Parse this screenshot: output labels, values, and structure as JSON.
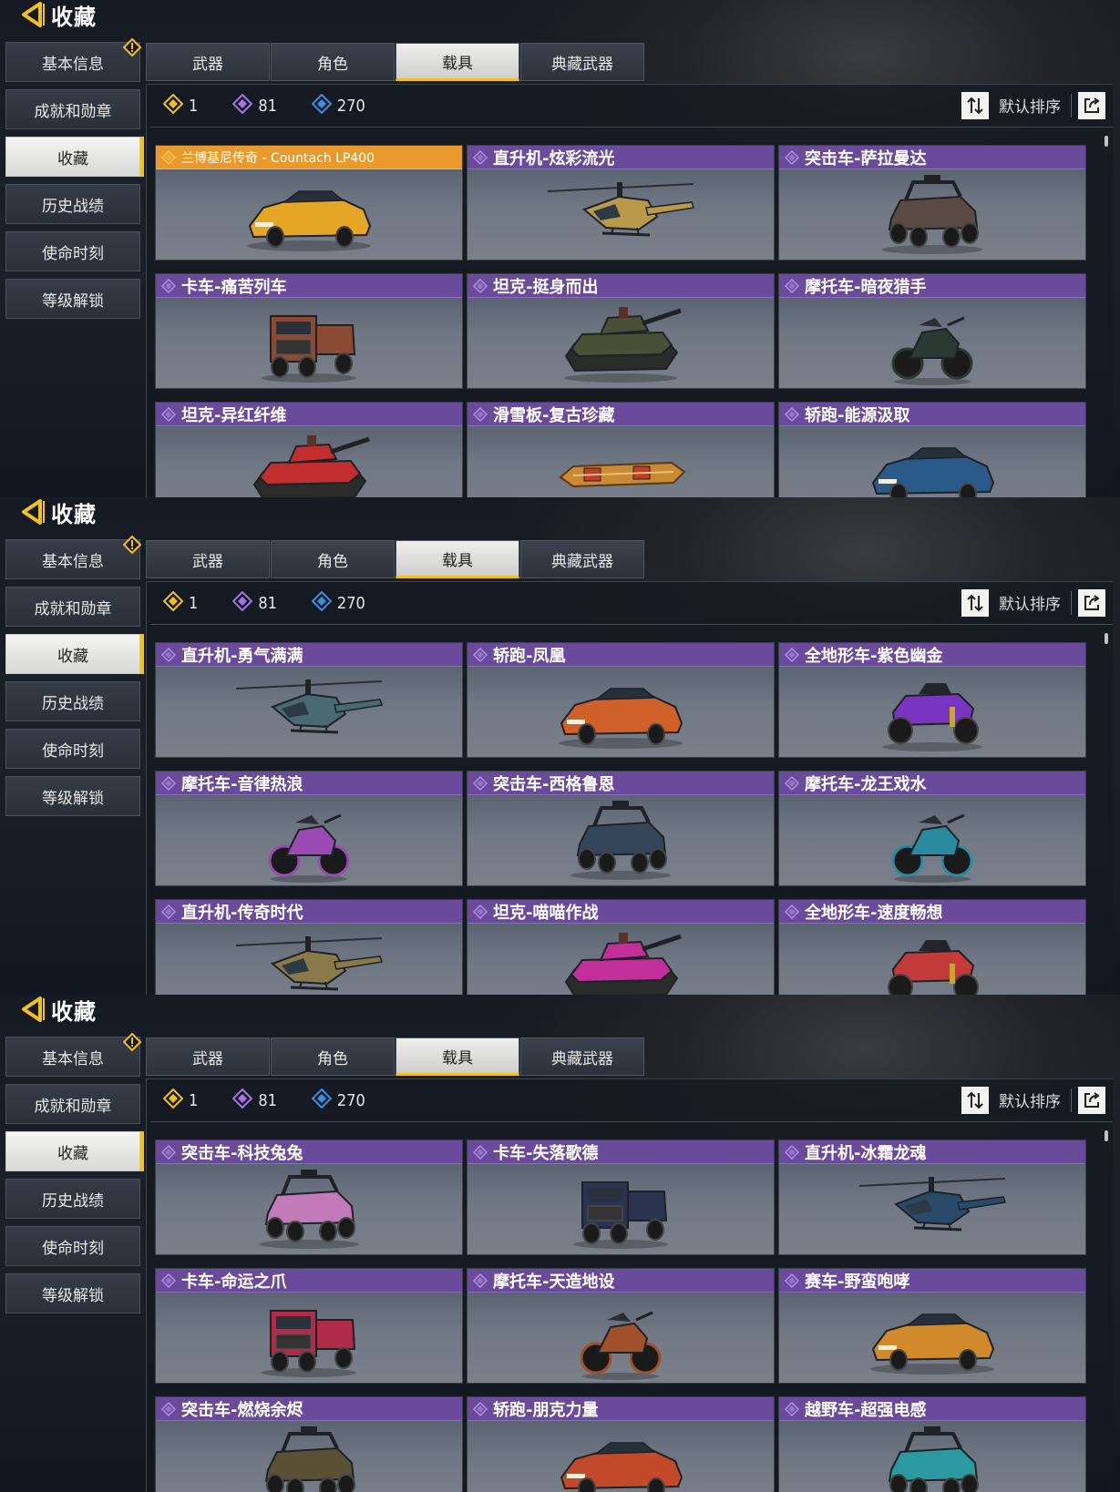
{
  "page_title": "收藏",
  "side_nav": [
    {
      "label": "基本信息",
      "warning": true
    },
    {
      "label": "成就和勋章"
    },
    {
      "label": "收藏",
      "active": true
    },
    {
      "label": "历史战绩"
    },
    {
      "label": "使命时刻"
    },
    {
      "label": "等级解锁"
    }
  ],
  "tabs": [
    {
      "label": "武器"
    },
    {
      "label": "角色"
    },
    {
      "label": "载具",
      "active": true
    },
    {
      "label": "典藏武器"
    }
  ],
  "currencies": [
    {
      "value": "1",
      "color": "#f2c21b",
      "icon": "gold-diamond-icon"
    },
    {
      "value": "81",
      "color": "#a475e8",
      "icon": "purple-diamond-icon"
    },
    {
      "value": "270",
      "color": "#3c8fe0",
      "icon": "blue-diamond-icon"
    }
  ],
  "sort_label": "默认排序",
  "screens": [
    {
      "cards": [
        {
          "name": "兰博基尼传奇 - Countach LP400",
          "rarity": "gold",
          "vehicle": "sports-car-icon",
          "color": "#e6a626"
        },
        {
          "name": "直升机-炫彩流光",
          "rarity": "purple",
          "vehicle": "helicopter-icon",
          "color": "#b89a4a"
        },
        {
          "name": "突击车-萨拉曼达",
          "rarity": "purple",
          "vehicle": "buggy-icon",
          "color": "#5a4a44"
        },
        {
          "name": "卡车-痛苦列车",
          "rarity": "purple",
          "vehicle": "truck-icon",
          "color": "#8a4a34"
        },
        {
          "name": "坦克-挺身而出",
          "rarity": "purple",
          "vehicle": "tank-icon",
          "color": "#4a5036"
        },
        {
          "name": "摩托车-暗夜猎手",
          "rarity": "purple",
          "vehicle": "motorcycle-icon",
          "color": "#2a3a32"
        },
        {
          "name": "坦克-异红纤维",
          "rarity": "purple",
          "vehicle": "tank-icon",
          "color": "#c22e2e"
        },
        {
          "name": "滑雪板-复古珍藏",
          "rarity": "purple",
          "vehicle": "snowboard-icon",
          "color": "#c88a34"
        },
        {
          "name": "轿跑-能源汲取",
          "rarity": "purple",
          "vehicle": "coupe-icon",
          "color": "#2a5a8a"
        }
      ]
    },
    {
      "cards": [
        {
          "name": "直升机-勇气满满",
          "rarity": "purple",
          "vehicle": "helicopter-icon",
          "color": "#4a6a72"
        },
        {
          "name": "轿跑-凤凰",
          "rarity": "purple",
          "vehicle": "coupe-icon",
          "color": "#d0602a"
        },
        {
          "name": "全地形车-紫色幽金",
          "rarity": "purple",
          "vehicle": "atv-icon",
          "color": "#7a34c2"
        },
        {
          "name": "摩托车-音律热浪",
          "rarity": "purple",
          "vehicle": "motorcycle-icon",
          "color": "#9a4ab0"
        },
        {
          "name": "突击车-西格鲁恩",
          "rarity": "purple",
          "vehicle": "buggy-icon",
          "color": "#34465a"
        },
        {
          "name": "摩托车-龙王戏水",
          "rarity": "purple",
          "vehicle": "motorcycle-icon",
          "color": "#2a8aa0"
        },
        {
          "name": "直升机-传奇时代",
          "rarity": "purple",
          "vehicle": "helicopter-icon",
          "color": "#8a7a4a"
        },
        {
          "name": "坦克-喵喵作战",
          "rarity": "purple",
          "vehicle": "tank-icon",
          "color": "#c22e9a"
        },
        {
          "name": "全地形车-速度畅想",
          "rarity": "purple",
          "vehicle": "atv-icon",
          "color": "#c23a3a"
        }
      ]
    },
    {
      "cards": [
        {
          "name": "突击车-科技兔兔",
          "rarity": "purple",
          "vehicle": "buggy-icon",
          "color": "#c27ab8"
        },
        {
          "name": "卡车-失落歌德",
          "rarity": "purple",
          "vehicle": "truck-icon",
          "color": "#2a3450"
        },
        {
          "name": "直升机-冰霜龙魂",
          "rarity": "purple",
          "vehicle": "helicopter-icon",
          "color": "#2a4a6a"
        },
        {
          "name": "卡车-命运之爪",
          "rarity": "purple",
          "vehicle": "truck-icon",
          "color": "#b02a4a"
        },
        {
          "name": "摩托车-天造地设",
          "rarity": "purple",
          "vehicle": "motorcycle-icon",
          "color": "#a0502a"
        },
        {
          "name": "赛车-野蛮咆哮",
          "rarity": "purple",
          "vehicle": "race-car-icon",
          "color": "#d08a2a"
        },
        {
          "name": "突击车-燃烧余烬",
          "rarity": "purple",
          "vehicle": "buggy-icon",
          "color": "#5a5036"
        },
        {
          "name": "轿跑-朋克力量",
          "rarity": "purple",
          "vehicle": "coupe-icon",
          "color": "#c24a2a"
        },
        {
          "name": "越野车-超强电感",
          "rarity": "purple",
          "vehicle": "offroad-icon",
          "color": "#2a9aa0"
        }
      ]
    }
  ]
}
